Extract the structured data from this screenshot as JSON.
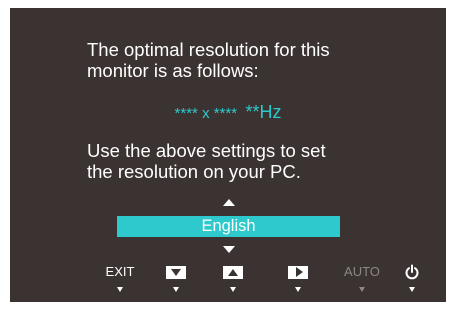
{
  "message": {
    "line1": "The optimal resolution for this",
    "line2": "monitor is as follows:",
    "resolution": "**** x ****",
    "refresh": "**Hz",
    "line3": "Use the above settings to set",
    "line4": "the resolution on your PC."
  },
  "language": {
    "selected": "English"
  },
  "buttons": {
    "exit": "EXIT",
    "auto": "AUTO"
  },
  "colors": {
    "panel": "#3b3332",
    "accent": "#2ec9cc",
    "text": "#ffffff",
    "disabled": "#8c8685"
  },
  "icons": [
    "down-arrow-icon",
    "up-arrow-icon",
    "right-arrow-icon",
    "power-icon"
  ]
}
